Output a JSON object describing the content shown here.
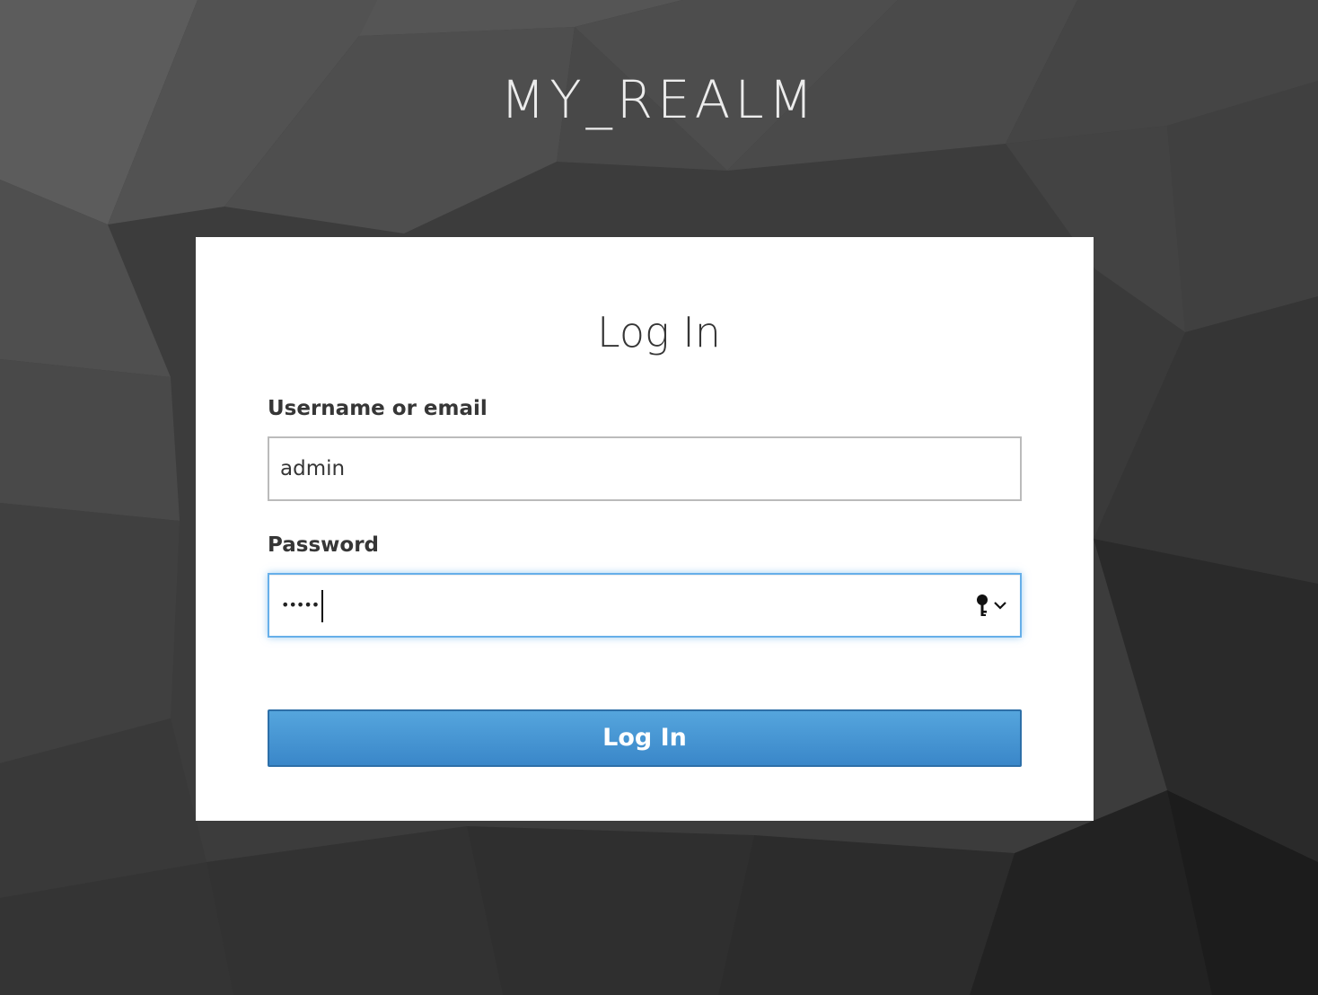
{
  "realm": {
    "title": "MY_REALM"
  },
  "login": {
    "heading": "Log In",
    "username": {
      "label": "Username or email",
      "value": "admin"
    },
    "password": {
      "label": "Password",
      "masked_value": "•••••",
      "focused": true,
      "icon": "key-icon"
    },
    "submit_label": "Log In"
  },
  "colors": {
    "background": "#3a3a3a",
    "card": "#ffffff",
    "button": "#3f8fd2",
    "focus_ring": "#66afe9"
  }
}
